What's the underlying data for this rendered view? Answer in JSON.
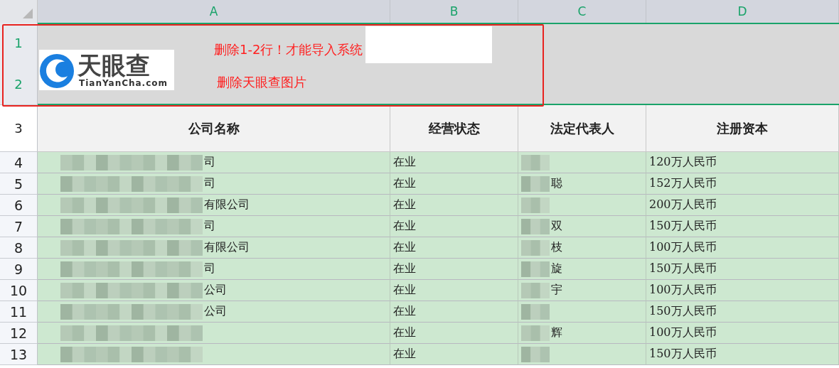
{
  "columns": [
    "A",
    "B",
    "C",
    "D"
  ],
  "banner": {
    "row_numbers": [
      "1",
      "2"
    ],
    "logo": {
      "name": "天眼查",
      "domain": "TianYanCha.com"
    },
    "notes": [
      "删除1-2行！才能导入系统",
      "删除天眼查图片"
    ]
  },
  "header": {
    "row_number": "3",
    "cells": [
      "公司名称",
      "经营状态",
      "法定代表人",
      "注册资本"
    ]
  },
  "rows": [
    {
      "row_number": "4",
      "company": "司",
      "redacted": true,
      "status": "在业",
      "representative": "",
      "capital": "120万人民币"
    },
    {
      "row_number": "5",
      "company": "司",
      "redacted": true,
      "status": "在业",
      "representative": "聪",
      "capital": "152万人民币"
    },
    {
      "row_number": "6",
      "company": "有限公司",
      "redacted": true,
      "status": "在业",
      "representative": "",
      "capital": "200万人民币"
    },
    {
      "row_number": "7",
      "company": "司",
      "redacted": true,
      "status": "在业",
      "representative": "双",
      "capital": "150万人民币"
    },
    {
      "row_number": "8",
      "company": "有限公司",
      "redacted": true,
      "status": "在业",
      "representative": "枝",
      "capital": "100万人民币"
    },
    {
      "row_number": "9",
      "company": "司",
      "redacted": true,
      "status": "在业",
      "representative": "旋",
      "capital": "150万人民币"
    },
    {
      "row_number": "10",
      "company": "公司",
      "redacted": true,
      "status": "在业",
      "representative": "宇",
      "capital": "100万人民币"
    },
    {
      "row_number": "11",
      "company": "公司",
      "redacted": true,
      "status": "在业",
      "representative": "",
      "capital": "150万人民币"
    },
    {
      "row_number": "12",
      "company": "",
      "redacted": true,
      "status": "在业",
      "representative": "辉",
      "capital": "100万人民币"
    },
    {
      "row_number": "13",
      "company": "",
      "redacted": true,
      "status": "在业",
      "representative": "",
      "capital": "150万人民币"
    }
  ]
}
